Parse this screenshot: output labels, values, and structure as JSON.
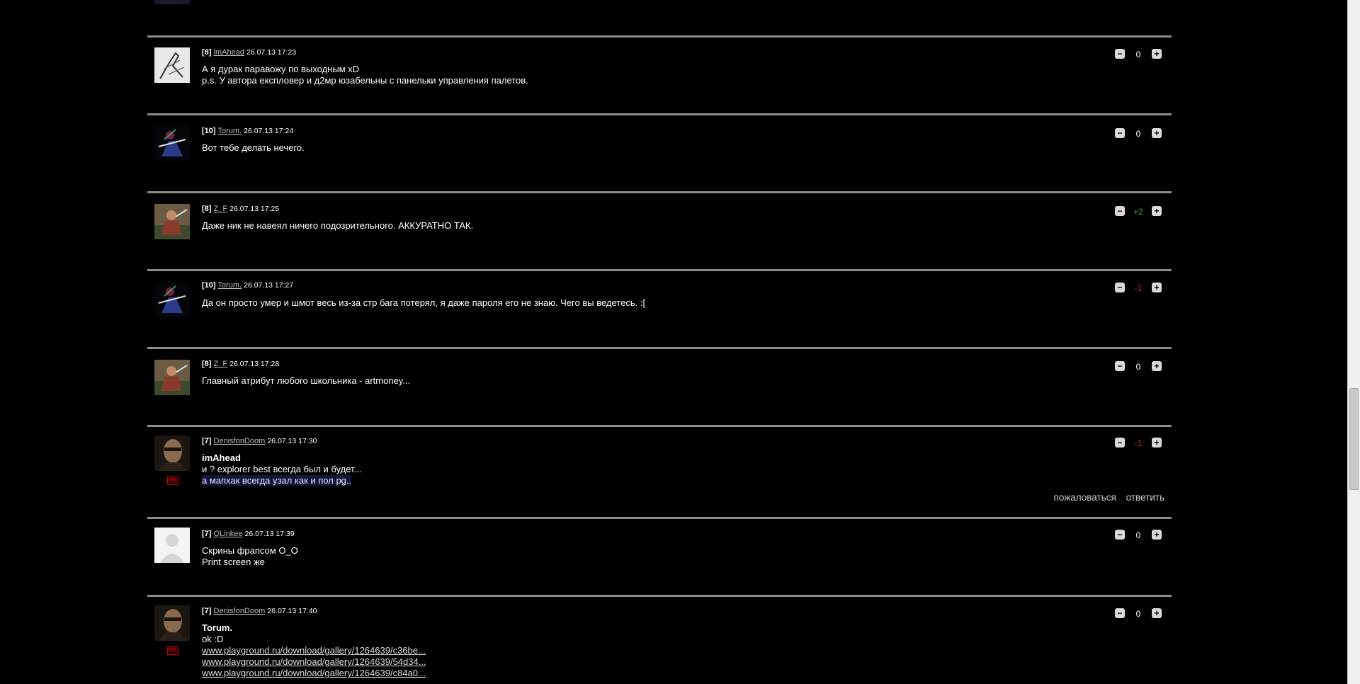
{
  "colors": {
    "positive": "#2db82d",
    "negative": "#d42020",
    "divider": "#8c8c8c"
  },
  "icons": {
    "minus": "minus-icon",
    "plus": "plus-icon",
    "pix_badge": "pix-badge"
  },
  "controls": {
    "minus_glyph": "−",
    "plus_glyph": "+",
    "pix_label": "PIX"
  },
  "comments": [
    {
      "level": "[8]",
      "user": "imAhead",
      "date": "26.07.13 17:23",
      "score": "0",
      "lines": [
        "А я дурак паравожу по выходным xD",
        "p.s. У автора експловер и д2мр юзабельны с панельки управления палетов."
      ]
    },
    {
      "level": "[10]",
      "user": "Torum.",
      "date": "26.07.13 17:24",
      "score": "0",
      "lines": [
        "Вот тебе делать нечего."
      ]
    },
    {
      "level": "[8]",
      "user": "Z_F",
      "date": "26.07.13 17:25",
      "score": "+2",
      "lines": [
        "Даже ник не навеял ничего подозрительного. АККУРАТНО ТАК."
      ]
    },
    {
      "level": "[10]",
      "user": "Torum.",
      "date": "26.07.13 17:27",
      "score": "-1",
      "lines": [
        "Да он просто умер и шмот весь из-за стр бага потерял, я даже пароля его не знаю. Чего вы ведетесь. :["
      ]
    },
    {
      "level": "[8]",
      "user": "Z_F",
      "date": "26.07.13 17:28",
      "score": "0",
      "lines": [
        "Главный атрибут любого школьника - artmoney..."
      ]
    },
    {
      "level": "[7]",
      "user": "DenisfonDoom",
      "date": "26.07.13 17:30",
      "score": "-1",
      "reply_to": "imAhead",
      "lines": [
        "и ? explorer best всегда был и будет..."
      ],
      "quote": "а мапхак всегда узал как и пол pg..",
      "actions": {
        "report": "пожаловаться",
        "reply": "ответить"
      }
    },
    {
      "level": "[7]",
      "user": "QLinkee",
      "date": "26.07.13 17:39",
      "score": "0",
      "lines": [
        "Скрины фрапсом O_O",
        "Print screen же"
      ]
    },
    {
      "level": "[7]",
      "user": "DenisfonDoom",
      "date": "26.07.13 17:40",
      "score": "0",
      "reply_to": "Torum.",
      "lines": [
        "ok :D"
      ],
      "links": [
        "www.playground.ru/download/gallery/1264639/c36be...",
        "www.playground.ru/download/gallery/1264639/54d34...",
        "www.playground.ru/download/gallery/1264639/c84a0..."
      ]
    }
  ]
}
